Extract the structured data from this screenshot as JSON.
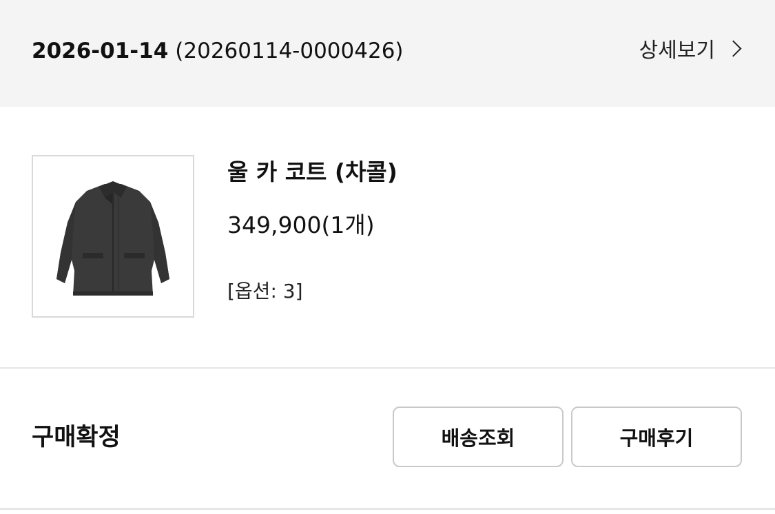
{
  "order": {
    "date": "2026-01-14",
    "number": "(20260114-0000426)",
    "detail_label": "상세보기",
    "status": "구매확정"
  },
  "product": {
    "name": "울 카 코트 (차콜)",
    "price": "349,900(1개)",
    "option": "[옵션: 3]",
    "image_icon": "charcoal-coat-thumbnail"
  },
  "actions": {
    "tracking_label": "배송조회",
    "review_label": "구매후기"
  },
  "colors": {
    "header_bg": "#f4f4f4",
    "coat": "#3a3a3a",
    "border": "#c9c9c9"
  }
}
